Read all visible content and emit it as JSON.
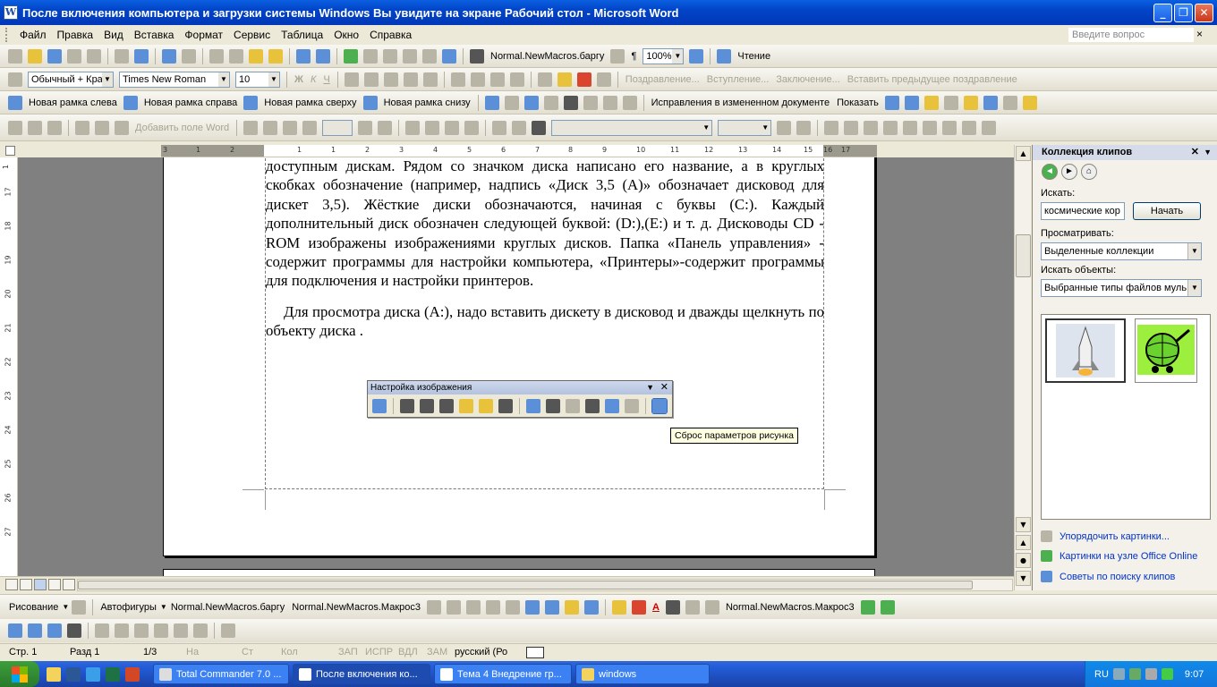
{
  "window": {
    "title": "После включения компьютера и загрузки системы Windows Вы увидите на экране Рабочий стол - Microsoft Word",
    "min_label": "_",
    "max_label": "❐",
    "close_label": "✕"
  },
  "menu": {
    "items": [
      "Файл",
      "Правка",
      "Вид",
      "Вставка",
      "Формат",
      "Сервис",
      "Таблица",
      "Окно",
      "Справка"
    ],
    "ask_placeholder": "Введите вопрос",
    "close_glyph": "×"
  },
  "toolbar_standard": {
    "macro_label": "Normal.NewMacros.баргу",
    "zoom": "100%",
    "read_label": "Чтение",
    "pilcrow": "¶"
  },
  "toolbar_formatting": {
    "style": "Обычный + Кра",
    "font": "Times New Roman",
    "size": "10",
    "bold": "Ж",
    "italic": "К",
    "underline": "Ч",
    "autotext": [
      "Поздравление...",
      "Вступление...",
      "Заключение...",
      "Вставить предыдущее поздравление"
    ]
  },
  "toolbar_frames": {
    "items": [
      "Новая рамка слева",
      "Новая рамка справа",
      "Новая рамка сверху",
      "Новая рамка снизу"
    ],
    "track_changes": "Исправления в измененном документе",
    "show_label": "Показать"
  },
  "toolbar_mailmerge": {
    "add_field": "Добавить поле Word"
  },
  "ruler": {
    "h_ticks": [
      "3",
      "1",
      "2",
      "1",
      "1",
      "2",
      "3",
      "4",
      "5",
      "6",
      "7",
      "8",
      "9",
      "10",
      "11",
      "12",
      "13",
      "14",
      "15",
      "16",
      "17"
    ],
    "v_ticks": [
      "1",
      "17",
      "18",
      "19",
      "20",
      "21",
      "22",
      "23",
      "24",
      "25",
      "26",
      "27"
    ]
  },
  "document": {
    "paragraph1": "доступным дискам. Рядом со значком диска написано его название, а в круглых скобках обозначение (например, надпись «Диск 3,5 (А)» обозначает дисковод для дискет 3,5).  Жёсткие диски обозначаются, начиная с буквы (С:). Каждый дополнительный диск обозначен следующей буквой: (D:),(Е:) и т. д. Дисководы CD - ROM изображены изображениями круглых дисков. Папка «Панель управления» - содержит программы для настройки компьютера, «Принтеры»-содержит программы для подключения и настройки принтеров.",
    "paragraph2": "Для просмотра диска (А:), надо вставить дискету в дисковод и дважды щелкнуть по объекту диска ."
  },
  "picture_toolbar": {
    "title": "Настройка изображения",
    "tooltip": "Сброс параметров рисунка"
  },
  "taskpane": {
    "title": "Коллекция клипов",
    "search_label": "Искать:",
    "search_value": "космические кор",
    "go_button": "Начать",
    "browse_label": "Просматривать:",
    "browse_value": "Выделенные коллекции",
    "types_label": "Искать объекты:",
    "types_value": "Выбранные типы файлов муль",
    "links": [
      "Упорядочить картинки...",
      "Картинки на узле Office Online",
      "Советы по поиску клипов"
    ]
  },
  "drawing": {
    "draw_label": "Рисование",
    "autoshapes_label": "Автофигуры",
    "macro1": "Normal.NewMacros.баргу",
    "macro2": "Normal.NewMacros.Макрос3",
    "macro3": "Normal.NewMacros.Макрос3",
    "font_color_glyph": "A"
  },
  "status": {
    "page": "Стр. 1",
    "section": "Разд 1",
    "pages": "1/3",
    "at": "На",
    "line": "Ст",
    "col": "Кол",
    "rec": "ЗАП",
    "trk": "ИСПР",
    "ext": "ВДЛ",
    "ovr": "ЗАМ",
    "lang": "русский (Ро"
  },
  "taskbar": {
    "tasks": [
      "Total Commander 7.0 ...",
      "После включения ко...",
      "Тема 4 Внедрение гр...",
      "windows"
    ],
    "lang": "RU",
    "time": "9:07"
  },
  "colors": {
    "titlebar": "#0244c7",
    "taskbar": "#245edb",
    "start": "#3c9e3c",
    "link": "#0033cc"
  }
}
